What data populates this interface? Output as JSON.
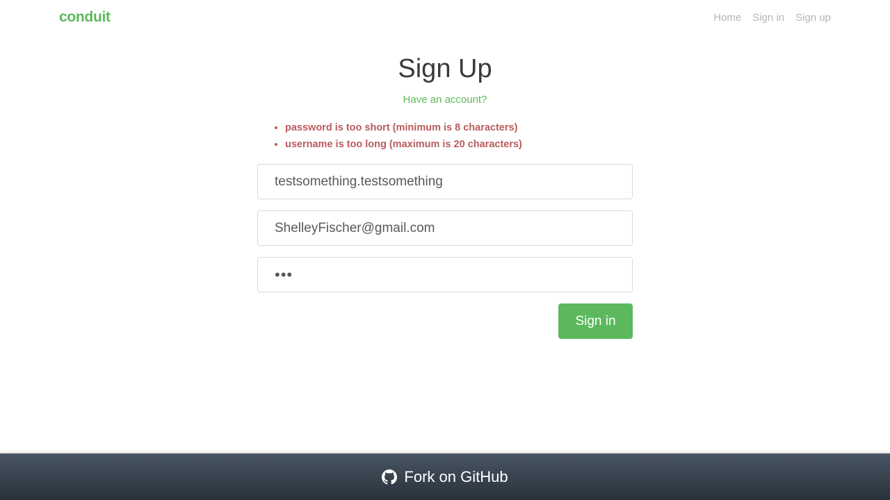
{
  "navbar": {
    "brand": "conduit",
    "links": [
      "Home",
      "Sign in",
      "Sign up"
    ]
  },
  "page": {
    "title": "Sign Up",
    "have_account_link": "Have an account?"
  },
  "errors": [
    "password is too short (minimum is 8 characters)",
    "username is too long (maximum is 20 characters)"
  ],
  "form": {
    "username_value": "testsomething.testsomething",
    "email_value": "ShelleyFischer@gmail.com",
    "password_value": "•••",
    "submit_label": "Sign in"
  },
  "footer": {
    "icon": "github-icon",
    "text": "Fork on GitHub"
  },
  "colors": {
    "brand": "#5cb85c",
    "error": "#b85c5c",
    "footer_top": "#485563",
    "footer_bottom": "#29323c"
  }
}
